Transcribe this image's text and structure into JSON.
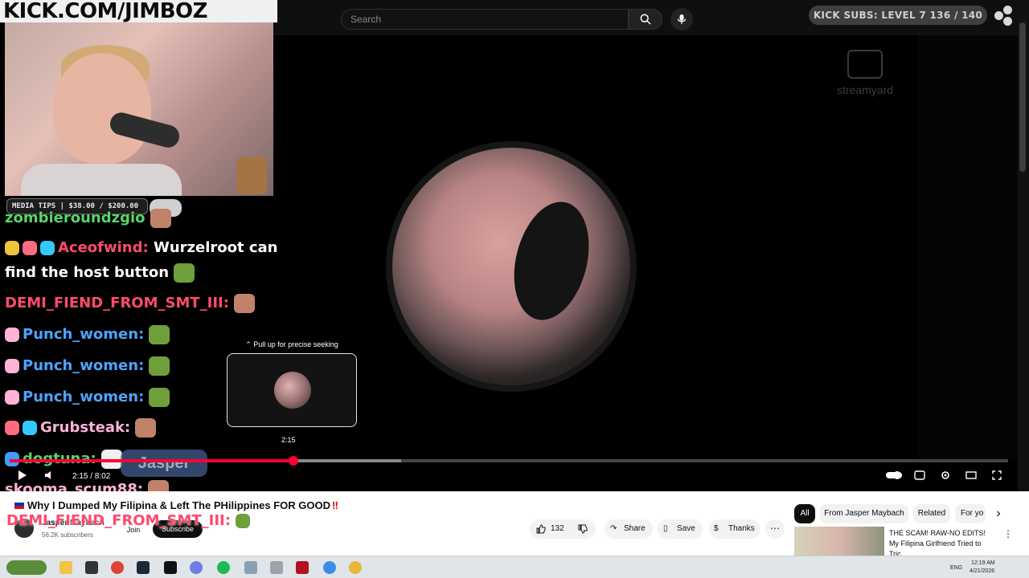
{
  "search": {
    "placeholder": "Search"
  },
  "overlay": {
    "banner": "KICK.COM/JIMBOZ",
    "tips": "MEDIA TIPS | $38.00 / $200.00",
    "subs": "KICK SUBS: LEVEL 7 136 / 140"
  },
  "chat": [
    {
      "name": "zombieroundzgio",
      "text": ""
    },
    {
      "name": "Aceofwind:",
      "text": "Wurzelroot can"
    },
    {
      "name": "",
      "text": "find the host button"
    },
    {
      "name": "DEMI_FIEND_FROM_SMT_III:",
      "text": ""
    },
    {
      "name": "Punch_women:",
      "text": ""
    },
    {
      "name": "Punch_women:",
      "text": ""
    },
    {
      "name": "Punch_women:",
      "text": ""
    },
    {
      "name": "Grubsteak:",
      "text": ""
    },
    {
      "name": "dogtuna:",
      "text": ""
    },
    {
      "name": "skooma_scum88:",
      "text": ""
    }
  ],
  "chat_bottom": {
    "name": "DEMI_FIEND_FROM_SMT_III:"
  },
  "player": {
    "pull_up": "Pull up for precise seeking",
    "seek_time": "2:15",
    "time": "2:15 / 8:02",
    "watermark": "streamyard",
    "name_overlay": "Jasper"
  },
  "video": {
    "title": "Why I Dumped My Filipina & Left The PHilippines FOR GOOD",
    "channel": "Jasper Maybach",
    "subscribers": "56.2K subscribers",
    "join": "Join",
    "subscribe": "Subscribe",
    "likes": "132",
    "share": "Share",
    "save": "Save",
    "thanks": "Thanks"
  },
  "chips": [
    "All",
    "From Jasper Maybach",
    "Related",
    "For yo"
  ],
  "recommendation": {
    "title": "THE SCAM! RAW-NO EDITS! My Filipina Girlfriend Tried to Tric..."
  },
  "taskbar": {
    "language": "ENG",
    "time": "12:19 AM",
    "date": "4/21/2026"
  },
  "colors": {
    "accent": "#ff0033",
    "player_bg": "#000000",
    "page_bg": "#ffffff"
  }
}
